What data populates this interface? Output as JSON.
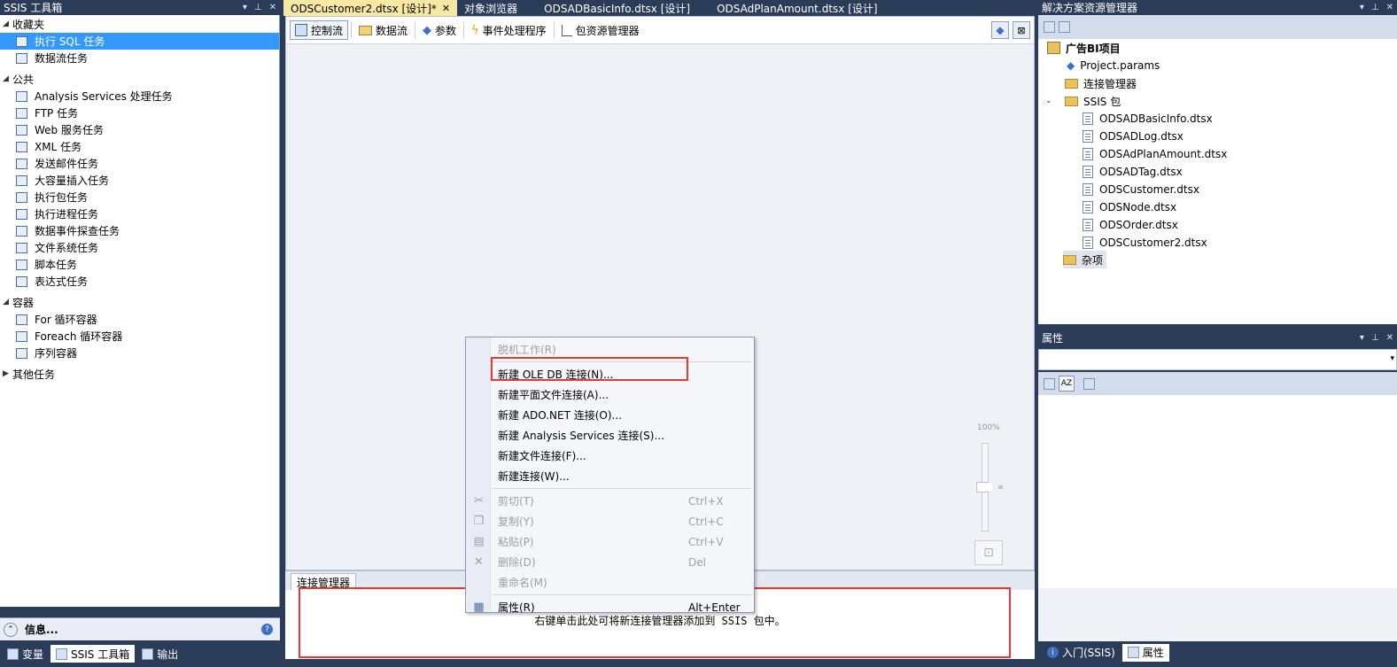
{
  "toolbox": {
    "title": "SSIS 工具箱",
    "groups": [
      {
        "label": "收藏夹",
        "items": [
          "执行 SQL 任务",
          "数据流任务"
        ]
      },
      {
        "label": "公共",
        "items": [
          "Analysis Services 处理任务",
          "FTP 任务",
          "Web 服务任务",
          "XML 任务",
          "发送邮件任务",
          "大容量插入任务",
          "执行包任务",
          "执行进程任务",
          "数据事件探查任务",
          "文件系统任务",
          "脚本任务",
          "表达式任务"
        ]
      },
      {
        "label": "容器",
        "items": [
          "For 循环容器",
          "Foreach 循环容器",
          "序列容器"
        ]
      },
      {
        "label": "其他任务",
        "items": []
      }
    ],
    "selected_item": "执行 SQL 任务",
    "info_label": "信息...",
    "bottom_tabs": [
      "变量",
      "SSIS 工具箱",
      "输出"
    ]
  },
  "doc_tabs": [
    {
      "label": "ODSCustomer2.dtsx [设计]*",
      "active": true
    },
    {
      "label": "对象浏览器",
      "active": false
    },
    {
      "label": "ODSADBasicInfo.dtsx [设计]",
      "active": false
    },
    {
      "label": "ODSAdPlanAmount.dtsx [设计]",
      "active": false
    }
  ],
  "designer_tabs": [
    "控制流",
    "数据流",
    "参数",
    "事件处理程序",
    "包资源管理器"
  ],
  "zoom_label": "100%",
  "connection_manager": {
    "tab_label": "连接管理器",
    "hint": "右键单击此处可将新连接管理器添加到 SSIS 包中。"
  },
  "context_menu": [
    {
      "label": "脱机工作(R)",
      "disabled": true,
      "shortcut": ""
    },
    {
      "sep": true
    },
    {
      "label": "新建 OLE DB 连接(N)...",
      "disabled": false,
      "shortcut": ""
    },
    {
      "label": "新建平面文件连接(A)...",
      "disabled": false,
      "shortcut": ""
    },
    {
      "label": "新建 ADO.NET 连接(O)...",
      "disabled": false,
      "shortcut": ""
    },
    {
      "label": "新建 Analysis Services 连接(S)...",
      "disabled": false,
      "shortcut": ""
    },
    {
      "label": "新建文件连接(F)...",
      "disabled": false,
      "shortcut": ""
    },
    {
      "label": "新建连接(W)...",
      "disabled": false,
      "shortcut": ""
    },
    {
      "sep": true
    },
    {
      "label": "剪切(T)",
      "disabled": true,
      "shortcut": "Ctrl+X",
      "icon": "scissors-icon"
    },
    {
      "label": "复制(Y)",
      "disabled": true,
      "shortcut": "Ctrl+C",
      "icon": "copy-icon"
    },
    {
      "label": "粘贴(P)",
      "disabled": true,
      "shortcut": "Ctrl+V",
      "icon": "paste-icon"
    },
    {
      "label": "删除(D)",
      "disabled": true,
      "shortcut": "Del",
      "icon": "delete-icon"
    },
    {
      "label": "重命名(M)",
      "disabled": true,
      "shortcut": ""
    },
    {
      "sep": true
    },
    {
      "label": "属性(R)",
      "disabled": false,
      "shortcut": "Alt+Enter",
      "icon": "properties-icon"
    }
  ],
  "solution_explorer": {
    "title": "解决方案资源管理器",
    "project": "广告BI项目",
    "params": "Project.params",
    "connections": "连接管理器",
    "packages_folder": "SSIS 包",
    "packages": [
      "ODSADBasicInfo.dtsx",
      "ODSADLog.dtsx",
      "ODSAdPlanAmount.dtsx",
      "ODSADTag.dtsx",
      "ODSCustomer.dtsx",
      "ODSNode.dtsx",
      "ODSOrder.dtsx",
      "ODSCustomer2.dtsx"
    ],
    "misc": "杂项"
  },
  "properties": {
    "title": "属性",
    "bottom_tabs": [
      "入门(SSIS)",
      "属性"
    ]
  },
  "colors": {
    "frame": "#2b3c59",
    "selection": "#3399ff",
    "highlight": "#e53935",
    "active_tab": "#f7e8a4"
  }
}
